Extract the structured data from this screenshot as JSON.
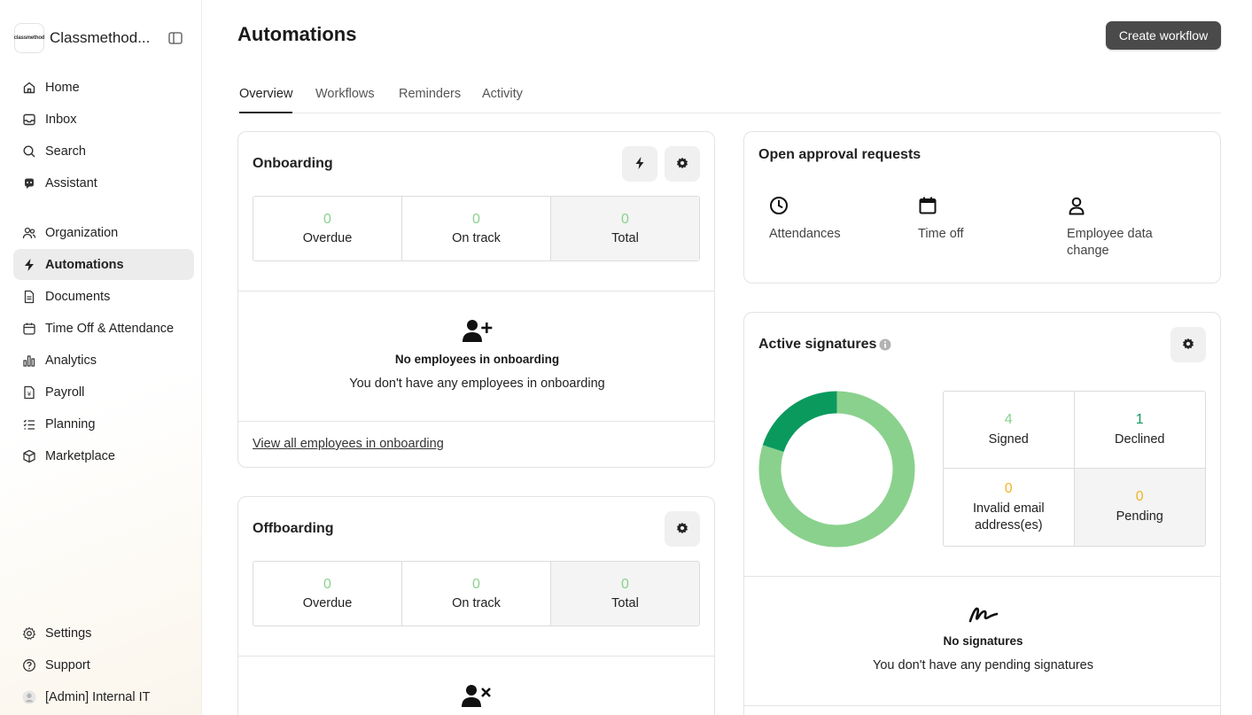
{
  "sidebar": {
    "brand_logo_text": "classmethod",
    "brand_name": "Classmethod...",
    "items": [
      {
        "label": "Home",
        "icon": "home-icon"
      },
      {
        "label": "Inbox",
        "icon": "inbox-icon"
      },
      {
        "label": "Search",
        "icon": "search-icon"
      },
      {
        "label": "Assistant",
        "icon": "assistant-icon"
      },
      {
        "label": "Organization",
        "icon": "organization-icon"
      },
      {
        "label": "Automations",
        "icon": "lightning-icon",
        "active": true
      },
      {
        "label": "Documents",
        "icon": "document-icon"
      },
      {
        "label": "Time Off & Attendance",
        "icon": "calendar-icon"
      },
      {
        "label": "Analytics",
        "icon": "analytics-icon"
      },
      {
        "label": "Payroll",
        "icon": "payroll-icon"
      },
      {
        "label": "Planning",
        "icon": "planning-icon"
      },
      {
        "label": "Marketplace",
        "icon": "marketplace-icon"
      }
    ],
    "footer": [
      {
        "label": "Settings",
        "icon": "gear-icon"
      },
      {
        "label": "Support",
        "icon": "help-icon"
      },
      {
        "label": "[Admin] Internal IT",
        "icon": "avatar-icon"
      }
    ]
  },
  "header": {
    "title": "Automations",
    "create_button": "Create workflow"
  },
  "tabs": [
    "Overview",
    "Workflows",
    "Reminders",
    "Activity"
  ],
  "active_tab": "Overview",
  "onboarding": {
    "title": "Onboarding",
    "stats": [
      {
        "value": "0",
        "label": "Overdue"
      },
      {
        "value": "0",
        "label": "On track"
      },
      {
        "value": "0",
        "label": "Total"
      }
    ],
    "empty_title": "No employees in onboarding",
    "empty_text": "You don't have any employees in onboarding",
    "link": "View all employees in onboarding"
  },
  "offboarding": {
    "title": "Offboarding",
    "stats": [
      {
        "value": "0",
        "label": "Overdue"
      },
      {
        "value": "0",
        "label": "On track"
      },
      {
        "value": "0",
        "label": "Total"
      }
    ]
  },
  "approvals": {
    "title": "Open approval requests",
    "items": [
      {
        "label": "Attendances",
        "icon": "clock-icon"
      },
      {
        "label": "Time off",
        "icon": "calendar-icon"
      },
      {
        "label": "Employee data change",
        "icon": "user-icon"
      }
    ]
  },
  "signatures": {
    "title": "Active signatures",
    "stats": [
      {
        "value": "4",
        "label": "Signed",
        "color": "#8ad18d"
      },
      {
        "value": "1",
        "label": "Declined",
        "color": "#0b9a5e"
      },
      {
        "value": "0",
        "label": "Invalid email address(es)",
        "color": "#f0b429"
      },
      {
        "value": "0",
        "label": "Pending",
        "color": "#f0b429"
      }
    ],
    "chart_colors": {
      "signed": "#8ad18d",
      "declined": "#0b9a5e"
    },
    "empty_title": "No signatures",
    "empty_text": "You don't have any pending signatures"
  }
}
